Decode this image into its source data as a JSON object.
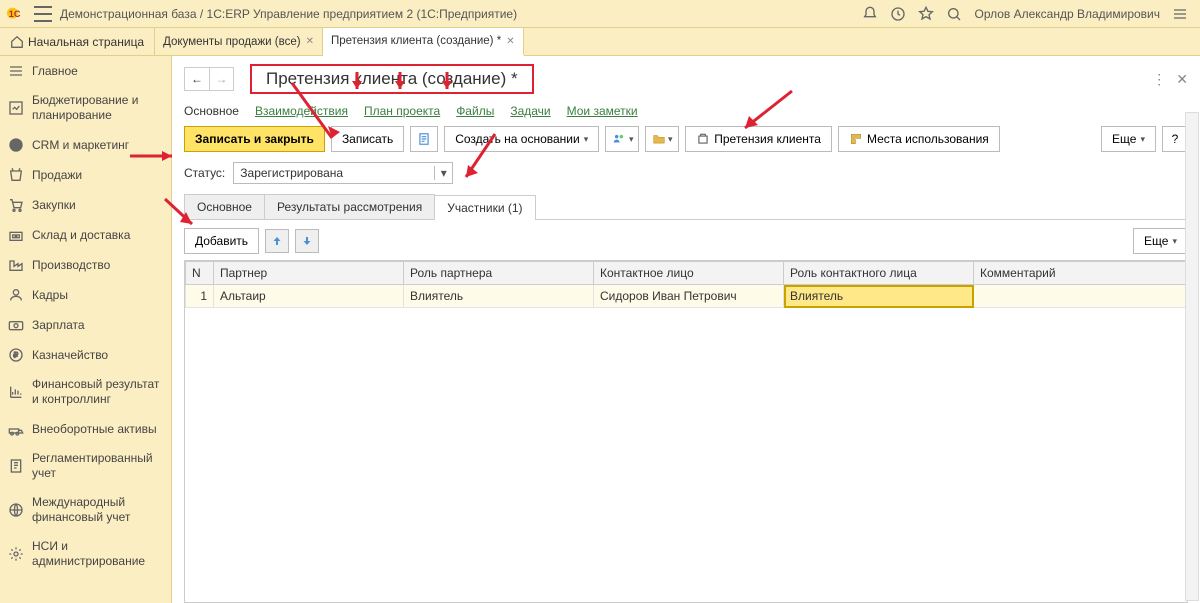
{
  "titlebar": {
    "title": "Демонстрационная база / 1C:ERP Управление предприятием 2  (1С:Предприятие)",
    "user": "Орлов Александр Владимирович"
  },
  "tabs": {
    "home": "Начальная страница",
    "items": [
      {
        "label": "Документы продажи (все)",
        "active": false
      },
      {
        "label": "Претензия клиента (создание) *",
        "active": true
      }
    ]
  },
  "sidebar": [
    "Главное",
    "Бюджетирование и планирование",
    "CRM и маркетинг",
    "Продажи",
    "Закупки",
    "Склад и доставка",
    "Производство",
    "Кадры",
    "Зарплата",
    "Казначейство",
    "Финансовый результат и контроллинг",
    "Внеоборотные активы",
    "Регламентированный учет",
    "Международный финансовый учет",
    "НСИ и администрирование"
  ],
  "page": {
    "title": "Претензия клиента (создание) *",
    "link_tabs": [
      "Основное",
      "Взаимодействия",
      "План проекта",
      "Файлы",
      "Задачи",
      "Мои заметки"
    ],
    "toolbar": {
      "save_close": "Записать и закрыть",
      "save": "Записать",
      "create_based": "Создать на основании",
      "claim": "Претензия клиента",
      "usage": "Места использования",
      "more": "Еще",
      "help": "?"
    },
    "status_label": "Статус:",
    "status_value": "Зарегистрирована",
    "inner_tabs": [
      "Основное",
      "Результаты рассмотрения",
      "Участники (1)"
    ],
    "inner_active": 2,
    "sub_add": "Добавить",
    "sub_more": "Еще",
    "grid": {
      "cols": [
        "N",
        "Партнер",
        "Роль партнера",
        "Контактное лицо",
        "Роль контактного лица",
        "Комментарий"
      ],
      "rows": [
        {
          "n": "1",
          "partner": "Альтаир",
          "prole": "Влиятель",
          "contact": "Сидоров Иван Петрович",
          "crole": "Влиятель",
          "comment": ""
        }
      ]
    }
  }
}
